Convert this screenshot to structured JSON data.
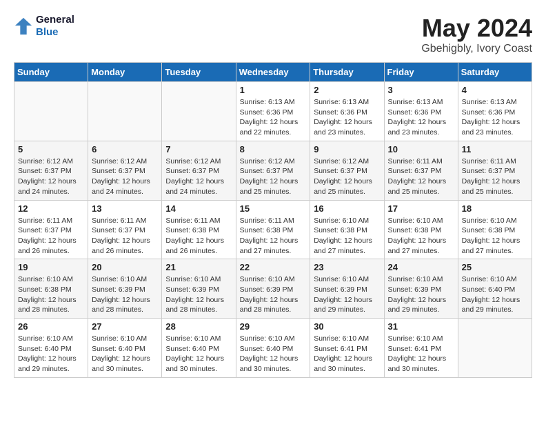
{
  "header": {
    "logo_line1": "General",
    "logo_line2": "Blue",
    "month": "May 2024",
    "location": "Gbehigbly, Ivory Coast"
  },
  "weekdays": [
    "Sunday",
    "Monday",
    "Tuesday",
    "Wednesday",
    "Thursday",
    "Friday",
    "Saturday"
  ],
  "weeks": [
    [
      {
        "day": "",
        "info": ""
      },
      {
        "day": "",
        "info": ""
      },
      {
        "day": "",
        "info": ""
      },
      {
        "day": "1",
        "info": "Sunrise: 6:13 AM\nSunset: 6:36 PM\nDaylight: 12 hours\nand 22 minutes."
      },
      {
        "day": "2",
        "info": "Sunrise: 6:13 AM\nSunset: 6:36 PM\nDaylight: 12 hours\nand 23 minutes."
      },
      {
        "day": "3",
        "info": "Sunrise: 6:13 AM\nSunset: 6:36 PM\nDaylight: 12 hours\nand 23 minutes."
      },
      {
        "day": "4",
        "info": "Sunrise: 6:13 AM\nSunset: 6:36 PM\nDaylight: 12 hours\nand 23 minutes."
      }
    ],
    [
      {
        "day": "5",
        "info": "Sunrise: 6:12 AM\nSunset: 6:37 PM\nDaylight: 12 hours\nand 24 minutes."
      },
      {
        "day": "6",
        "info": "Sunrise: 6:12 AM\nSunset: 6:37 PM\nDaylight: 12 hours\nand 24 minutes."
      },
      {
        "day": "7",
        "info": "Sunrise: 6:12 AM\nSunset: 6:37 PM\nDaylight: 12 hours\nand 24 minutes."
      },
      {
        "day": "8",
        "info": "Sunrise: 6:12 AM\nSunset: 6:37 PM\nDaylight: 12 hours\nand 25 minutes."
      },
      {
        "day": "9",
        "info": "Sunrise: 6:12 AM\nSunset: 6:37 PM\nDaylight: 12 hours\nand 25 minutes."
      },
      {
        "day": "10",
        "info": "Sunrise: 6:11 AM\nSunset: 6:37 PM\nDaylight: 12 hours\nand 25 minutes."
      },
      {
        "day": "11",
        "info": "Sunrise: 6:11 AM\nSunset: 6:37 PM\nDaylight: 12 hours\nand 25 minutes."
      }
    ],
    [
      {
        "day": "12",
        "info": "Sunrise: 6:11 AM\nSunset: 6:37 PM\nDaylight: 12 hours\nand 26 minutes."
      },
      {
        "day": "13",
        "info": "Sunrise: 6:11 AM\nSunset: 6:37 PM\nDaylight: 12 hours\nand 26 minutes."
      },
      {
        "day": "14",
        "info": "Sunrise: 6:11 AM\nSunset: 6:38 PM\nDaylight: 12 hours\nand 26 minutes."
      },
      {
        "day": "15",
        "info": "Sunrise: 6:11 AM\nSunset: 6:38 PM\nDaylight: 12 hours\nand 27 minutes."
      },
      {
        "day": "16",
        "info": "Sunrise: 6:10 AM\nSunset: 6:38 PM\nDaylight: 12 hours\nand 27 minutes."
      },
      {
        "day": "17",
        "info": "Sunrise: 6:10 AM\nSunset: 6:38 PM\nDaylight: 12 hours\nand 27 minutes."
      },
      {
        "day": "18",
        "info": "Sunrise: 6:10 AM\nSunset: 6:38 PM\nDaylight: 12 hours\nand 27 minutes."
      }
    ],
    [
      {
        "day": "19",
        "info": "Sunrise: 6:10 AM\nSunset: 6:38 PM\nDaylight: 12 hours\nand 28 minutes."
      },
      {
        "day": "20",
        "info": "Sunrise: 6:10 AM\nSunset: 6:39 PM\nDaylight: 12 hours\nand 28 minutes."
      },
      {
        "day": "21",
        "info": "Sunrise: 6:10 AM\nSunset: 6:39 PM\nDaylight: 12 hours\nand 28 minutes."
      },
      {
        "day": "22",
        "info": "Sunrise: 6:10 AM\nSunset: 6:39 PM\nDaylight: 12 hours\nand 28 minutes."
      },
      {
        "day": "23",
        "info": "Sunrise: 6:10 AM\nSunset: 6:39 PM\nDaylight: 12 hours\nand 29 minutes."
      },
      {
        "day": "24",
        "info": "Sunrise: 6:10 AM\nSunset: 6:39 PM\nDaylight: 12 hours\nand 29 minutes."
      },
      {
        "day": "25",
        "info": "Sunrise: 6:10 AM\nSunset: 6:40 PM\nDaylight: 12 hours\nand 29 minutes."
      }
    ],
    [
      {
        "day": "26",
        "info": "Sunrise: 6:10 AM\nSunset: 6:40 PM\nDaylight: 12 hours\nand 29 minutes."
      },
      {
        "day": "27",
        "info": "Sunrise: 6:10 AM\nSunset: 6:40 PM\nDaylight: 12 hours\nand 30 minutes."
      },
      {
        "day": "28",
        "info": "Sunrise: 6:10 AM\nSunset: 6:40 PM\nDaylight: 12 hours\nand 30 minutes."
      },
      {
        "day": "29",
        "info": "Sunrise: 6:10 AM\nSunset: 6:40 PM\nDaylight: 12 hours\nand 30 minutes."
      },
      {
        "day": "30",
        "info": "Sunrise: 6:10 AM\nSunset: 6:41 PM\nDaylight: 12 hours\nand 30 minutes."
      },
      {
        "day": "31",
        "info": "Sunrise: 6:10 AM\nSunset: 6:41 PM\nDaylight: 12 hours\nand 30 minutes."
      },
      {
        "day": "",
        "info": ""
      }
    ]
  ]
}
